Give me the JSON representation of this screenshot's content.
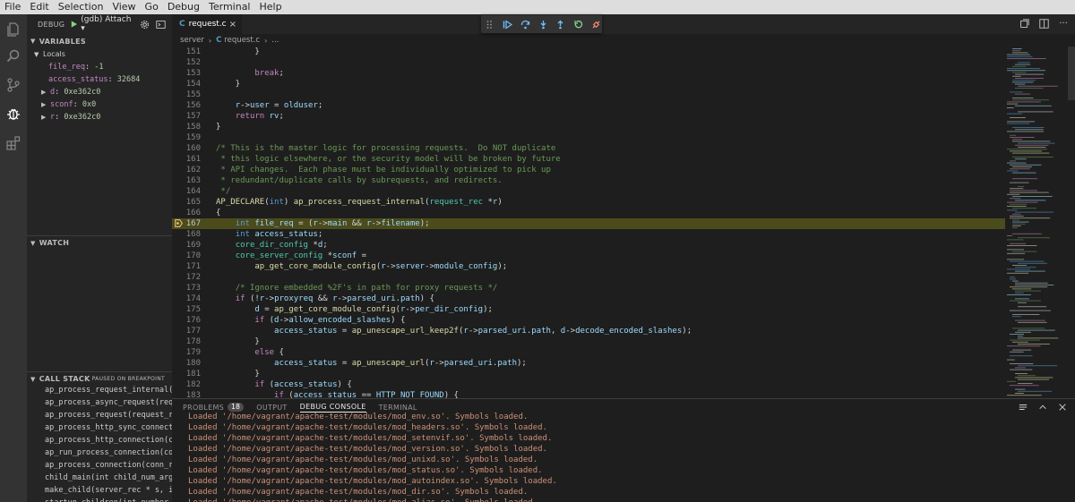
{
  "menubar": [
    "File",
    "Edit",
    "Selection",
    "View",
    "Go",
    "Debug",
    "Terminal",
    "Help"
  ],
  "activitybar": {
    "items": [
      "files-icon",
      "search-icon",
      "source-control-icon",
      "debug-icon",
      "extensions-icon"
    ],
    "active": "debug-icon"
  },
  "sidebar": {
    "debug_label": "DEBUG",
    "config": "(gdb) Attach",
    "variables_title": "VARIABLES",
    "locals_label": "Locals",
    "variables": [
      {
        "name": "file_req",
        "value": "-1",
        "expandable": false
      },
      {
        "name": "access_status",
        "value": "32684",
        "expandable": false
      },
      {
        "name": "d",
        "value": "0xe362c0",
        "expandable": true
      },
      {
        "name": "sconf",
        "value": "0x0",
        "expandable": true
      },
      {
        "name": "r",
        "value": "0xe362c0",
        "expandable": true
      }
    ],
    "watch_title": "WATCH",
    "callstack_title": "CALL STACK",
    "callstack_status": "PAUSED ON BREAKPOINT",
    "callstack": [
      "ap_process_request_internal(r",
      "ap_process_async_request(requ",
      "ap_process_request(request_re",
      "ap_process_http_sync_connecti",
      "ap_process_http_connection(co",
      "ap_run_process_connection(con",
      "ap_process_connection(conn_re",
      "child_main(int child_num_arg,",
      "make_child(server_rec * s, in",
      "startup_children(int number_t"
    ]
  },
  "editor": {
    "tab_label": "request.c",
    "breadcrumb": [
      "server",
      "request.c",
      "..."
    ],
    "highlight_line": 167,
    "lines": [
      {
        "n": 151,
        "html": "        }"
      },
      {
        "n": 152,
        "html": ""
      },
      {
        "n": 153,
        "html": "        <span class=\"ctl\">break</span>;"
      },
      {
        "n": 154,
        "html": "    }"
      },
      {
        "n": 155,
        "html": ""
      },
      {
        "n": 156,
        "html": "    <span class=\"mb\">r</span>-><span class=\"mb\">user</span> = <span class=\"mb\">olduser</span>;"
      },
      {
        "n": 157,
        "html": "    <span class=\"ctl\">return</span> <span class=\"mb\">rv</span>;"
      },
      {
        "n": 158,
        "html": "}"
      },
      {
        "n": 159,
        "html": ""
      },
      {
        "n": 160,
        "html": "<span class=\"cm\">/* This is the master logic for processing requests.  Do NOT duplicate</span>"
      },
      {
        "n": 161,
        "html": "<span class=\"cm\"> * this logic elsewhere, or the security model will be broken by future</span>"
      },
      {
        "n": 162,
        "html": "<span class=\"cm\"> * API changes.  Each phase must be individually optimized to pick up</span>"
      },
      {
        "n": 163,
        "html": "<span class=\"cm\"> * redundant/duplicate calls by subrequests, and redirects.</span>"
      },
      {
        "n": 164,
        "html": "<span class=\"cm\"> */</span>"
      },
      {
        "n": 165,
        "html": "<span class=\"fn\">AP_DECLARE</span>(<span class=\"kw\">int</span>) <span class=\"fn\">ap_process_request_internal</span>(<span class=\"ty\">request_rec</span> *<span class=\"mb\">r</span>)"
      },
      {
        "n": 166,
        "html": "{"
      },
      {
        "n": 167,
        "html": "    <span class=\"kw\">int</span> <span class=\"mb\">file_req</span> = (<span class=\"mb\">r</span>-><span class=\"mb\">main</span> && <span class=\"mb\">r</span>-><span class=\"mb\">filename</span>);"
      },
      {
        "n": 168,
        "html": "    <span class=\"kw\">int</span> <span class=\"mb\">access_status</span>;"
      },
      {
        "n": 169,
        "html": "    <span class=\"ty\">core_dir_config</span> *<span class=\"mb\">d</span>;"
      },
      {
        "n": 170,
        "html": "    <span class=\"ty\">core_server_config</span> *<span class=\"mb\">sconf</span> ="
      },
      {
        "n": 171,
        "html": "        <span class=\"fn\">ap_get_core_module_config</span>(<span class=\"mb\">r</span>-><span class=\"mb\">server</span>-><span class=\"mb\">module_config</span>);"
      },
      {
        "n": 172,
        "html": ""
      },
      {
        "n": 173,
        "html": "    <span class=\"cm\">/* Ignore embedded %2F's in path for proxy requests */</span>"
      },
      {
        "n": 174,
        "html": "    <span class=\"ctl\">if</span> (!<span class=\"mb\">r</span>-><span class=\"mb\">proxyreq</span> && <span class=\"mb\">r</span>-><span class=\"mb\">parsed_uri</span>.<span class=\"mb\">path</span>) {"
      },
      {
        "n": 175,
        "html": "        <span class=\"mb\">d</span> = <span class=\"fn\">ap_get_core_module_config</span>(<span class=\"mb\">r</span>-><span class=\"mb\">per_dir_config</span>);"
      },
      {
        "n": 176,
        "html": "        <span class=\"ctl\">if</span> (<span class=\"mb\">d</span>-><span class=\"mb\">allow_encoded_slashes</span>) {"
      },
      {
        "n": 177,
        "html": "            <span class=\"mb\">access_status</span> = <span class=\"fn\">ap_unescape_url_keep2f</span>(<span class=\"mb\">r</span>-><span class=\"mb\">parsed_uri</span>.<span class=\"mb\">path</span>, <span class=\"mb\">d</span>-><span class=\"mb\">decode_encoded_slashes</span>);"
      },
      {
        "n": 178,
        "html": "        }"
      },
      {
        "n": 179,
        "html": "        <span class=\"ctl\">else</span> {"
      },
      {
        "n": 180,
        "html": "            <span class=\"mb\">access_status</span> = <span class=\"fn\">ap_unescape_url</span>(<span class=\"mb\">r</span>-><span class=\"mb\">parsed_uri</span>.<span class=\"mb\">path</span>);"
      },
      {
        "n": 181,
        "html": "        }"
      },
      {
        "n": 182,
        "html": "        <span class=\"ctl\">if</span> (<span class=\"mb\">access_status</span>) {"
      },
      {
        "n": 183,
        "html": "            <span class=\"ctl\">if</span> (<span class=\"mb\">access_status</span> == <span class=\"mb\">HTTP_NOT_FOUND</span>) {"
      }
    ]
  },
  "panel": {
    "tabs": [
      {
        "label": "PROBLEMS",
        "badge": "18",
        "active": false
      },
      {
        "label": "OUTPUT",
        "badge": null,
        "active": false
      },
      {
        "label": "DEBUG CONSOLE",
        "badge": null,
        "active": true
      },
      {
        "label": "TERMINAL",
        "badge": null,
        "active": false
      }
    ],
    "console": [
      "Loaded '/home/vagrant/apache-test/modules/mod_env.so'. Symbols loaded.",
      "Loaded '/home/vagrant/apache-test/modules/mod_headers.so'. Symbols loaded.",
      "Loaded '/home/vagrant/apache-test/modules/mod_setenvif.so'. Symbols loaded.",
      "Loaded '/home/vagrant/apache-test/modules/mod_version.so'. Symbols loaded.",
      "Loaded '/home/vagrant/apache-test/modules/mod_unixd.so'. Symbols loaded.",
      "Loaded '/home/vagrant/apache-test/modules/mod_status.so'. Symbols loaded.",
      "Loaded '/home/vagrant/apache-test/modules/mod_autoindex.so'. Symbols loaded.",
      "Loaded '/home/vagrant/apache-test/modules/mod_dir.so'. Symbols loaded.",
      "Loaded '/home/vagrant/apache-test/modules/mod_alias.so'. Symbols loaded."
    ]
  },
  "colors": {
    "accent": "#007acc",
    "highlight_line": "#4b4b1c",
    "breakpoint": "#e5c07b"
  }
}
